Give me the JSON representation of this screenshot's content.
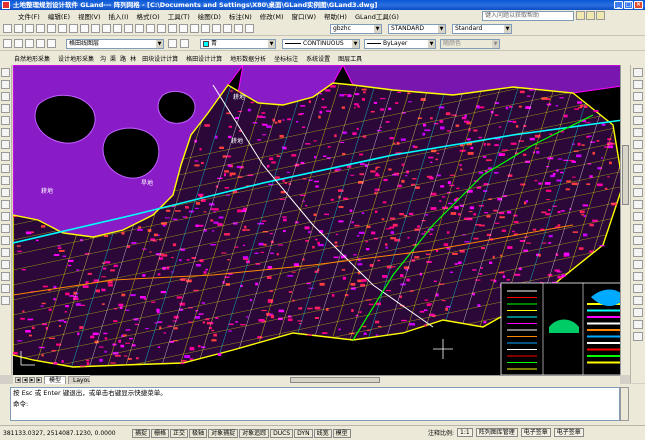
{
  "window": {
    "title": "土地整理规划设计软件 GLand--- 阵列网格 - [C:\\Documents and Settings\\X80\\桌面\\GLand实例图\\GLand3.dwg]",
    "controls": [
      "_",
      "□",
      "×"
    ]
  },
  "menu": {
    "items": [
      "文件(F)",
      "编辑(E)",
      "视图(V)",
      "插入(I)",
      "格式(O)",
      "工具(T)",
      "绘图(D)",
      "标注(N)",
      "修改(M)",
      "窗口(W)",
      "帮助(H)",
      "GLand工具(G)"
    ],
    "help_placeholder": "键入问题以获取帮助"
  },
  "toolbar1": {
    "style_combo": "gbzhc",
    "dim_combo": "STANDARD",
    "table_combo": "Standard"
  },
  "toolbar2": {
    "layer_combo": "格田线图层",
    "color_combo": "青",
    "linetype_combo": "CONTINUOUS",
    "lineweight_combo": "ByLayer",
    "plotstyle_combo": "随颜色"
  },
  "toolbar3": {
    "items": [
      "自然地形采集",
      "设计地形采集",
      "沟",
      "渠",
      "路",
      "林",
      "田块设计计算",
      "格田设计计算",
      "地形数据分析",
      "坐标标注",
      "系统设置",
      "图层工具"
    ]
  },
  "canvas": {
    "labels": [
      "耕地",
      "耕地",
      "旱地",
      "耕地"
    ],
    "colors": {
      "background": "#000000",
      "purple": "#8a1cc8",
      "magenta": "#ff00ff",
      "yellow": "#ffff00",
      "cyan": "#00ffff",
      "green": "#00ff00",
      "red": "#ff0000",
      "white": "#ffffff"
    }
  },
  "tabs": {
    "items": [
      "模型",
      "Layout1"
    ]
  },
  "command": {
    "line1": "按 Esc 或 Enter 键退出，或单击右键显示快捷菜单。",
    "prompt": "命令:"
  },
  "status": {
    "coords": "381133.0327, 2514087.1230, 0.0000",
    "toggles": [
      "捕捉",
      "栅格",
      "正交",
      "极轴",
      "对象捕捉",
      "对象追踪",
      "DUCS",
      "DYN",
      "线宽",
      "模型"
    ],
    "annotation_scale_label": "注释比例:",
    "annotation_scale": "1:1",
    "right_buttons": [
      "阵列图库管理",
      "电子签章",
      "电子签章"
    ]
  }
}
